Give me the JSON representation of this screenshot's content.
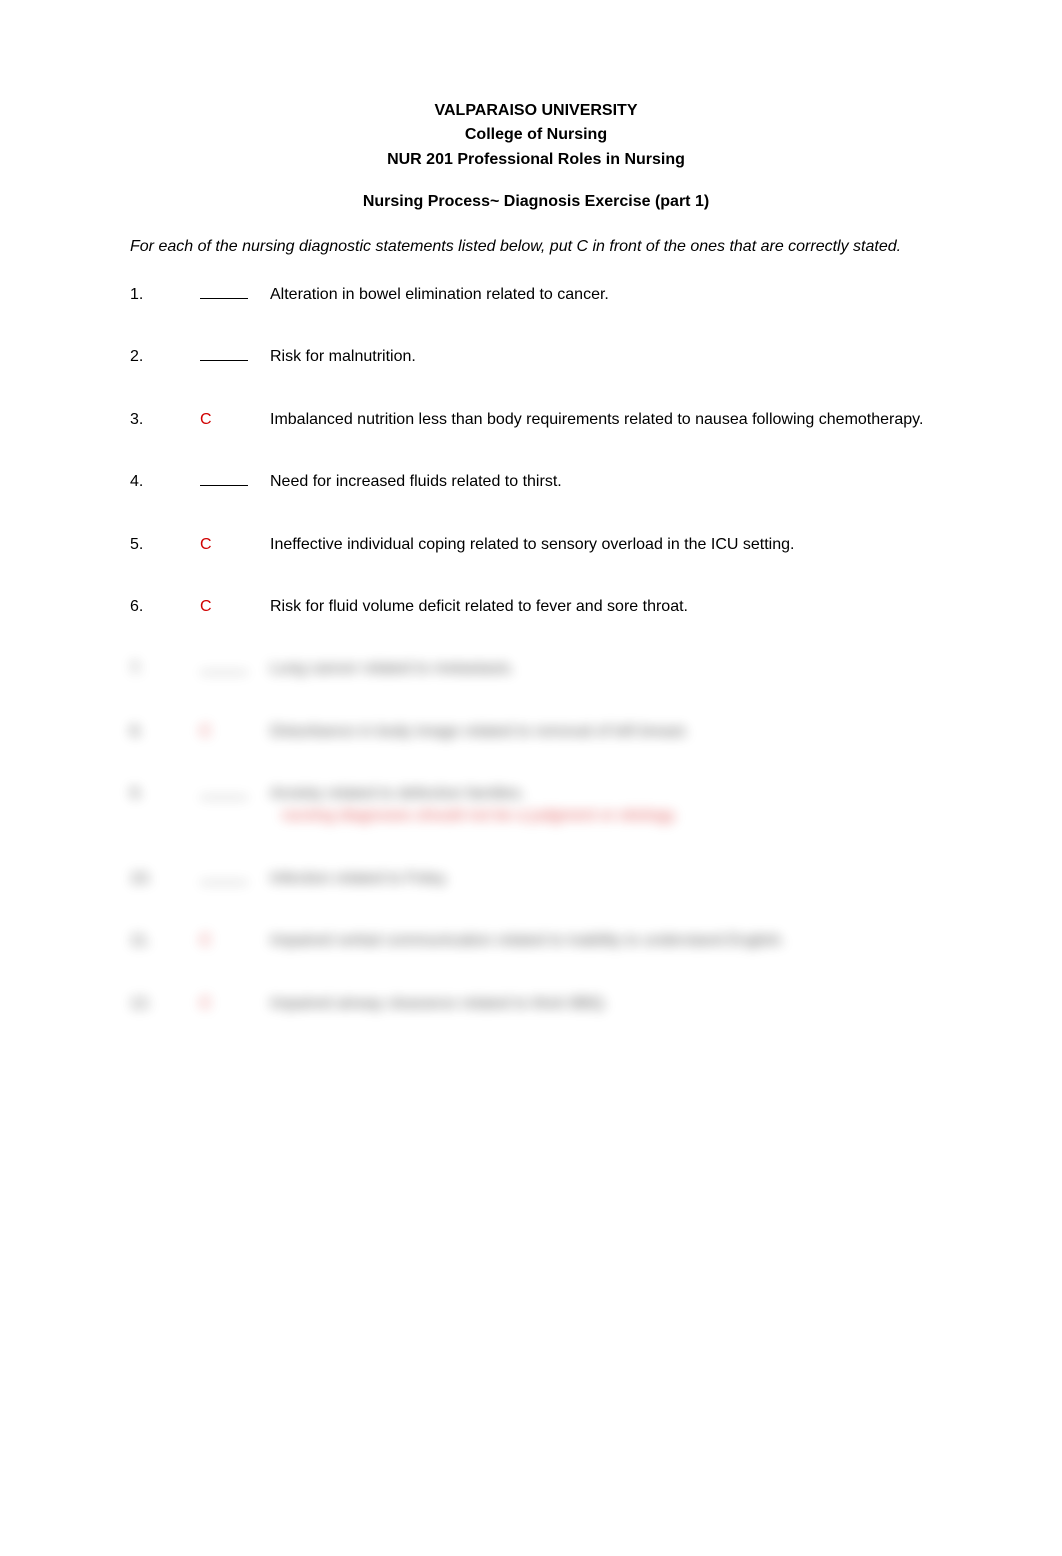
{
  "header": {
    "line1": "VALPARAISO UNIVERSITY",
    "line2": "College of Nursing",
    "line3": "NUR 201 Professional Roles in Nursing"
  },
  "subtitle": "Nursing Process~ Diagnosis Exercise (part 1)",
  "instructions": "For each of the nursing diagnostic statements listed below, put C in front of the ones that are correctly stated.",
  "items": [
    {
      "num": "1.",
      "mark": "",
      "hasBlank": true,
      "text": "Alteration in bowel elimination related to cancer.",
      "blurred": false
    },
    {
      "num": "2.",
      "mark": "",
      "hasBlank": true,
      "text": "Risk for malnutrition.",
      "blurred": false
    },
    {
      "num": "3.",
      "mark": "C",
      "hasBlank": false,
      "text": "Imbalanced nutrition less than body requirements related to nausea following chemotherapy.",
      "blurred": false,
      "indent": true
    },
    {
      "num": "4.",
      "mark": "",
      "hasBlank": true,
      "text": "Need for increased fluids related to thirst.",
      "blurred": false
    },
    {
      "num": "5.",
      "mark": "C",
      "hasBlank": false,
      "text": "Ineffective individual coping related to sensory overload in the ICU setting.",
      "blurred": false,
      "indent": true
    },
    {
      "num": "6.",
      "mark": "C",
      "hasBlank": false,
      "text": "Risk for fluid volume deficit related to fever and sore throat.",
      "blurred": false
    },
    {
      "num": "7.",
      "mark": "",
      "hasBlank": true,
      "text": "Lung cancer related to metastasis.",
      "blurred": true
    },
    {
      "num": "8.",
      "mark": "C",
      "hasBlank": false,
      "text": "Disturbance in body image related to removal of left breast.",
      "blurred": true
    },
    {
      "num": "9.",
      "mark": "",
      "hasBlank": true,
      "text": "Anxiety related to defective families.",
      "subtext": "nursing diagnoses should not be a judgment or etiology.",
      "blurred": true
    },
    {
      "num": "10.",
      "mark": "",
      "hasBlank": true,
      "text": "Infection related to Foley.",
      "blurred": true
    },
    {
      "num": "11.",
      "mark": "C",
      "hasBlank": false,
      "text": "Impaired verbal communication related to inability to understand English.",
      "blurred": true
    },
    {
      "num": "12.",
      "mark": "C",
      "hasBlank": false,
      "text": "Impaired airway clearance related to thick BBQ.",
      "blurred": true
    }
  ]
}
